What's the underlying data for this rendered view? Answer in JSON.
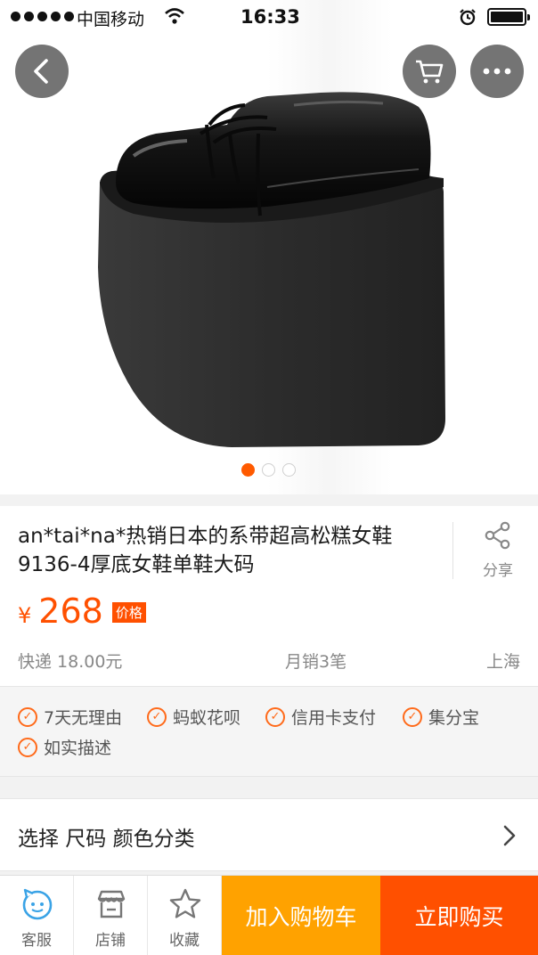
{
  "status_bar": {
    "carrier": "中国移动",
    "time": "16:33"
  },
  "gallery": {
    "total": 3,
    "active_index": 0
  },
  "product": {
    "title": "an*tai*na*热销日本的系带超高松糕女鞋9136-4厚底女鞋单鞋大码",
    "share_label": "分享",
    "currency": "¥",
    "price": "268",
    "price_tag": "价格",
    "shipping": "快递 18.00元",
    "monthly_sales": "月销3笔",
    "location": "上海"
  },
  "services": [
    "7天无理由",
    "蚂蚁花呗",
    "信用卡支付",
    "集分宝",
    "如实描述"
  ],
  "selection": {
    "label": "选择 尺码 颜色分类"
  },
  "bottom_bar": {
    "service_label": "客服",
    "shop_label": "店铺",
    "favorite_label": "收藏",
    "add_to_cart": "加入购物车",
    "buy_now": "立即购买"
  },
  "colors": {
    "accent": "#ff5000",
    "add_to_cart_bg": "#ffa200",
    "check": "#ff6a1a"
  },
  "icons": {
    "back": "chevron-left-icon",
    "cart": "shopping-cart-icon",
    "more": "more-dots-icon",
    "share": "share-icon",
    "service": "customer-service-icon",
    "shop": "store-icon",
    "favorite": "star-icon",
    "chevron": "chevron-right-icon"
  }
}
